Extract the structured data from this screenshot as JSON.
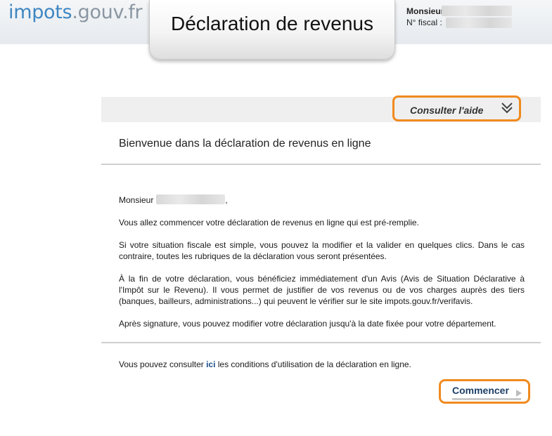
{
  "header": {
    "logo_part1": "impots",
    "logo_part2": ".gouv.fr",
    "title": "Déclaration de revenus",
    "user_label": "Monsieur",
    "fiscal_label": "N° fiscal :"
  },
  "help": {
    "label": "Consulter l'aide",
    "icon": "double-chevron-down-icon"
  },
  "main": {
    "welcome": "Bienvenue dans la déclaration de revenus en ligne",
    "greeting": "Monsieur",
    "greeting_suffix": ",",
    "p1": "Vous allez commencer votre déclaration de revenus en ligne qui est pré-remplie.",
    "p2": "Si votre situation fiscale est simple, vous pouvez la modifier et la valider en quelques clics. Dans le cas contraire, toutes les rubriques de la déclaration vous seront présentées.",
    "p3": "À la fin de votre déclaration, vous bénéficiez immédiatement d'un Avis (Avis de Situation Déclarative à l'Impôt sur le Revenu). Il vous permet de justifier de vos revenus ou de vos charges auprès des tiers (banques, bailleurs, administrations...) qui peuvent le vérifier sur le site impots.gouv.fr/verifavis.",
    "p4": "Après signature, vous pouvez modifier votre déclaration jusqu'à la date fixée pour votre département.",
    "p5_before": "Vous pouvez consulter ",
    "p5_link": "ici",
    "p5_after": " les conditions d'utilisation de la déclaration en ligne."
  },
  "actions": {
    "start_label": "Commencer",
    "start_icon": "triangle-right-icon"
  },
  "colors": {
    "accent_orange": "#f08a1e",
    "logo_blue": "#3e86c2",
    "logo_grey": "#8a96a2",
    "link_blue": "#1d4f8a"
  }
}
